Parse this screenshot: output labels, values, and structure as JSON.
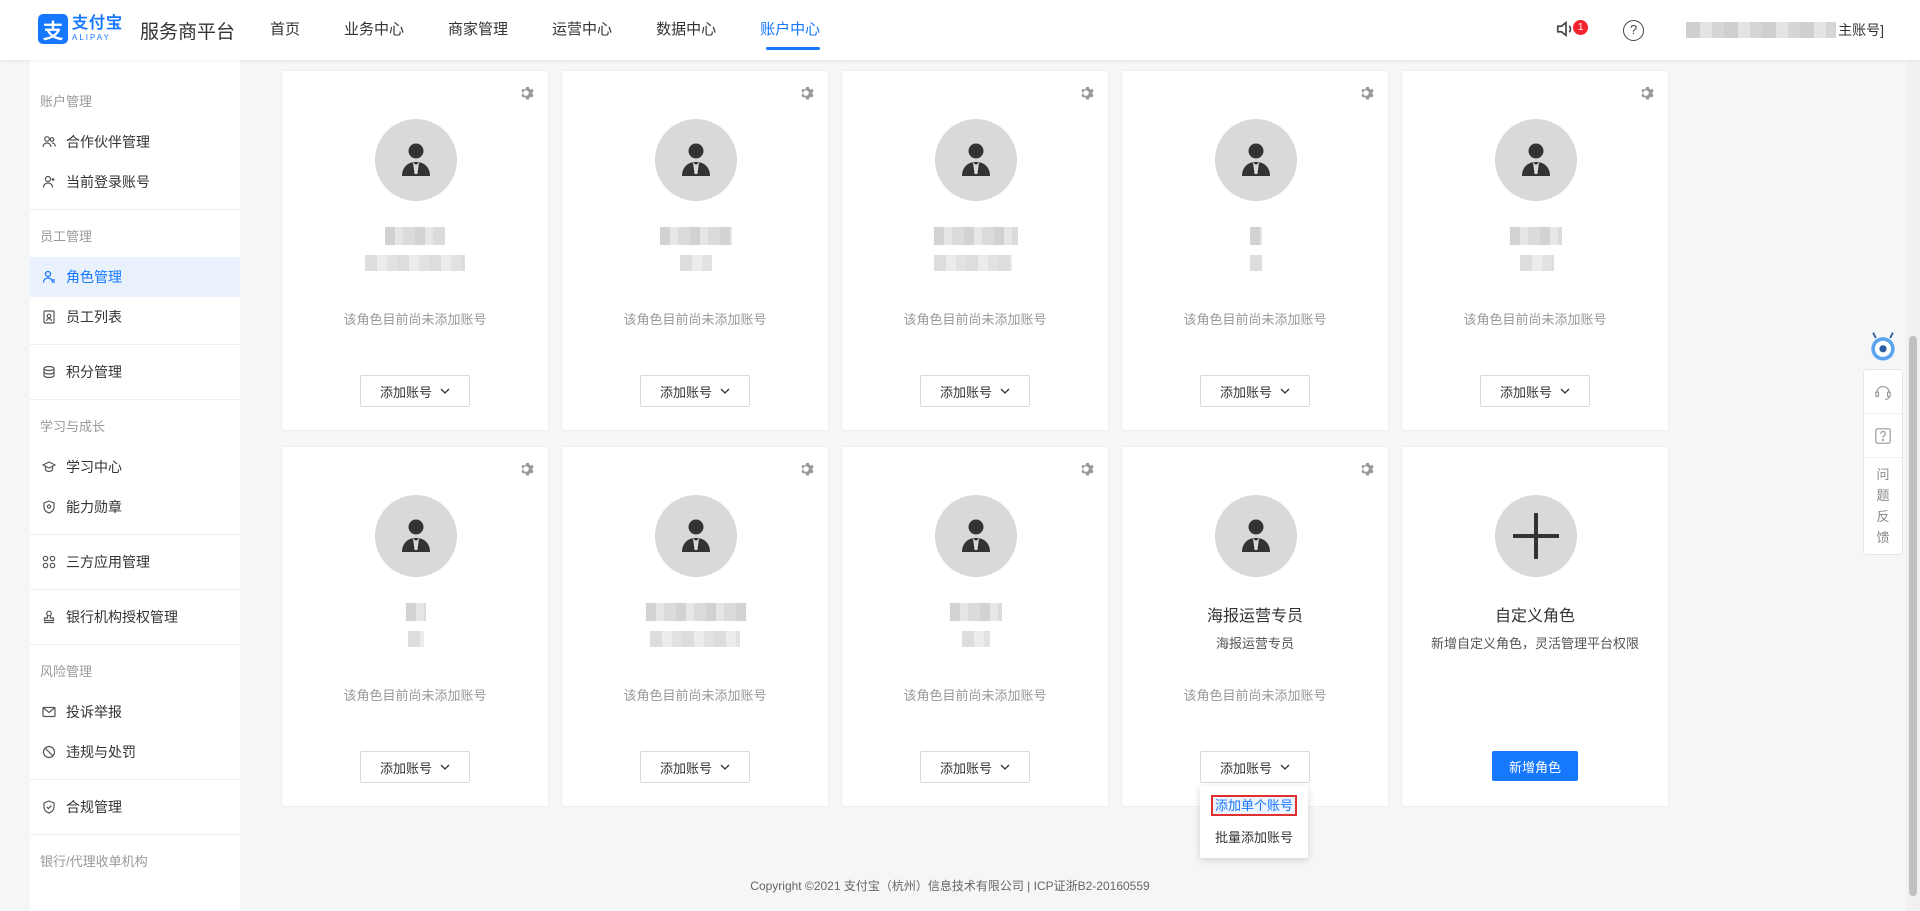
{
  "header": {
    "logo_mark": "支",
    "logo_cn": "支付宝",
    "logo_en": "ALIPAY",
    "platform": "服务商平台",
    "nav": [
      "首页",
      "业务中心",
      "商家管理",
      "运营中心",
      "数据中心",
      "账户中心"
    ],
    "active_nav": "账户中心",
    "badge_count": "1",
    "help": "?",
    "account_suffix": "主账号]"
  },
  "sidebar": {
    "groups": {
      "account": "账户管理",
      "staff": "员工管理",
      "learning": "学习与成长",
      "risk": "风险管理",
      "bank": "银行/代理收单机构"
    },
    "items": {
      "partner": "合作伙伴管理",
      "login_account": "当前登录账号",
      "role": "角色管理",
      "staff_list": "员工列表",
      "points": "积分管理",
      "learning_center": "学习中心",
      "badge": "能力勋章",
      "third_party": "三方应用管理",
      "bank_auth": "银行机构授权管理",
      "complaint": "投诉举报",
      "violation": "违规与处罚",
      "compliance": "合规管理"
    }
  },
  "cards": {
    "empty_tip": "该角色目前尚未添加账号",
    "add_button": "添加账号",
    "poster_role_name": "海报运营专员",
    "poster_role_desc": "海报运营专员",
    "custom_title": "自定义角色",
    "custom_desc": "新增自定义角色，灵活管理平台权限",
    "custom_button": "新增角色"
  },
  "dropdown": {
    "single": "添加单个账号",
    "batch": "批量添加账号"
  },
  "float": {
    "feedback": [
      "问",
      "题",
      "反",
      "馈"
    ]
  },
  "footer": "Copyright ©2021 支付宝（杭州）信息技术有限公司 | ICP证浙B2-20160559",
  "colors": {
    "accent": "#1677ff",
    "badge": "#f5222d",
    "highlight_border": "#e03131"
  }
}
